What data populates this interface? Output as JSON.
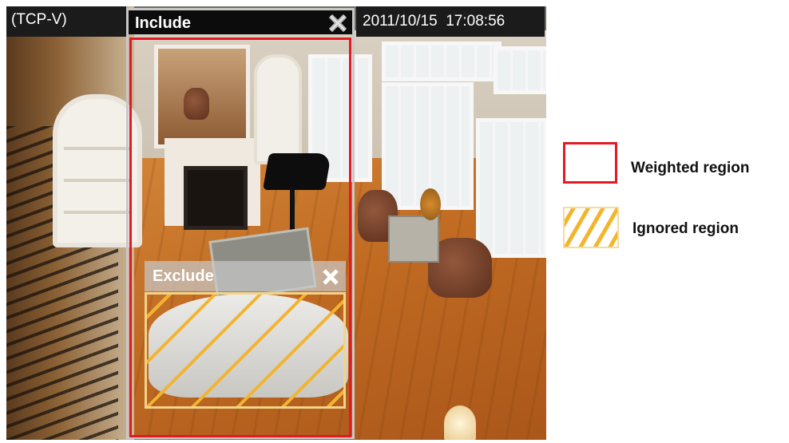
{
  "camera": {
    "stream_label": "(TCP-V)",
    "timestamp": "2011/10/15  17:08:56"
  },
  "include_window": {
    "title": "Include",
    "close_glyph": "X",
    "border_color": "#e01b24"
  },
  "exclude_window": {
    "title": "Exclude",
    "close_glyph": "X",
    "hatch_color": "#f2b430"
  },
  "legend": {
    "weighted_label": "Weighted region",
    "ignored_label": "Ignored region"
  },
  "icons": {
    "include_close": "close-icon",
    "exclude_close": "close-icon"
  }
}
